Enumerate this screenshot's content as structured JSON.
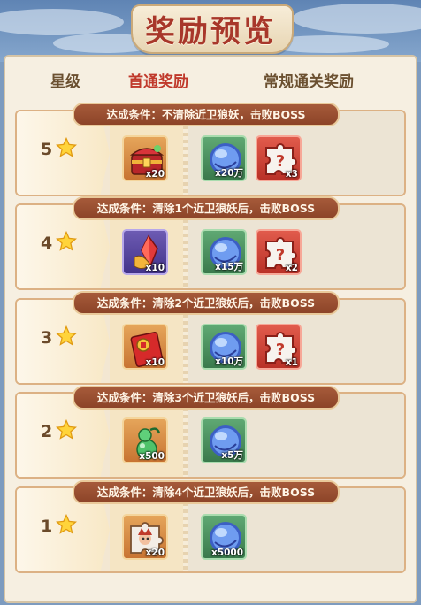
{
  "title": "奖励预览",
  "headers": {
    "level": "星级",
    "first": "首通奖励",
    "normal": "常规通关奖励"
  },
  "colors": {
    "accent": "#c0392b",
    "condition_bg": "#9a4f32"
  },
  "rows": [
    {
      "level": "5",
      "condition": "达成条件：不清除近卫狼妖，击败BOSS",
      "first": [
        {
          "icon": "treasure-chest-icon",
          "qty": "x20"
        }
      ],
      "normal": [
        {
          "icon": "spirit-orb-icon",
          "qty": "x20万"
        },
        {
          "icon": "mystery-puzzle-icon",
          "qty": "x3"
        }
      ]
    },
    {
      "level": "4",
      "condition": "达成条件：清除1个近卫狼妖后，击败BOSS",
      "first": [
        {
          "icon": "crimson-crystal-icon",
          "qty": "x10"
        }
      ],
      "normal": [
        {
          "icon": "spirit-orb-icon",
          "qty": "x15万"
        },
        {
          "icon": "mystery-puzzle-icon",
          "qty": "x2"
        }
      ]
    },
    {
      "level": "3",
      "condition": "达成条件：清除2个近卫狼妖后，击败BOSS",
      "first": [
        {
          "icon": "red-envelope-icon",
          "qty": "x10"
        }
      ],
      "normal": [
        {
          "icon": "spirit-orb-icon",
          "qty": "x10万"
        },
        {
          "icon": "mystery-puzzle-icon",
          "qty": "x1"
        }
      ]
    },
    {
      "level": "2",
      "condition": "达成条件：清除3个近卫狼妖后，击败BOSS",
      "first": [
        {
          "icon": "jade-gourd-icon",
          "qty": "x500"
        }
      ],
      "normal": [
        {
          "icon": "spirit-orb-icon",
          "qty": "x5万"
        }
      ]
    },
    {
      "level": "1",
      "condition": "达成条件：清除4个近卫狼妖后，击败BOSS",
      "first": [
        {
          "icon": "character-puzzle-icon",
          "qty": "x20"
        }
      ],
      "normal": [
        {
          "icon": "spirit-orb-icon",
          "qty": "x5000"
        }
      ]
    }
  ]
}
